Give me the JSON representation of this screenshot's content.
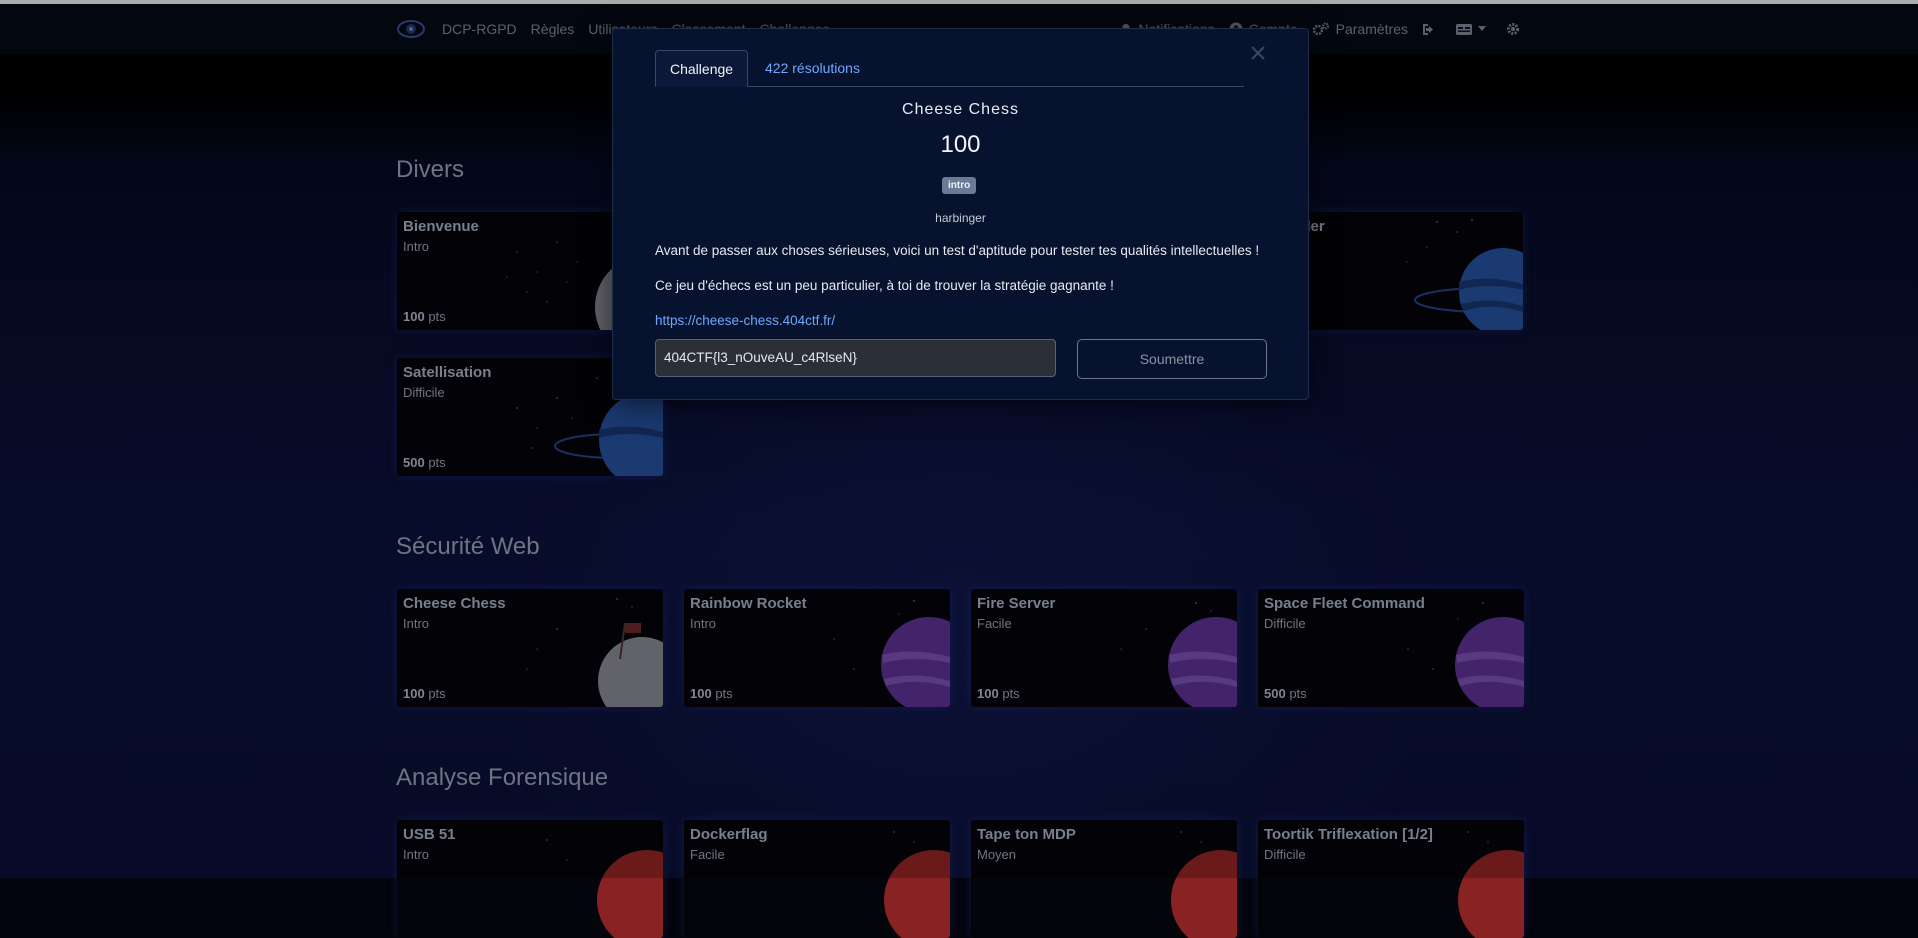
{
  "navbar": {
    "links": [
      "DCP-RGPD",
      "Règles",
      "Utilisateurs",
      "Classement",
      "Challenges"
    ],
    "right": {
      "notifications": "Notifications",
      "account": "Compte",
      "settings": "Paramètres"
    }
  },
  "sections": [
    {
      "title": "Divers",
      "cards": [
        {
          "name": "Bienvenue",
          "difficulty": "Intro",
          "points": "100",
          "unit": "pts"
        },
        {
          "name": "Traveller",
          "difficulty": "",
          "points": "",
          "unit": ""
        },
        {
          "name": "Satellisation",
          "difficulty": "Difficile",
          "points": "500",
          "unit": "pts"
        }
      ]
    },
    {
      "title": "Sécurité Web",
      "cards": [
        {
          "name": "Cheese Chess",
          "difficulty": "Intro",
          "points": "100",
          "unit": "pts"
        },
        {
          "name": "Rainbow Rocket",
          "difficulty": "Intro",
          "points": "100",
          "unit": "pts"
        },
        {
          "name": "Fire Server",
          "difficulty": "Facile",
          "points": "100",
          "unit": "pts"
        },
        {
          "name": "Space Fleet Command",
          "difficulty": "Difficile",
          "points": "500",
          "unit": "pts"
        }
      ]
    },
    {
      "title": "Analyse Forensique",
      "cards": [
        {
          "name": "USB 51",
          "difficulty": "Intro"
        },
        {
          "name": "Dockerflag",
          "difficulty": "Facile"
        },
        {
          "name": "Tape ton MDP",
          "difficulty": "Moyen"
        },
        {
          "name": "Toortik Triflexation [1/2]",
          "difficulty": "Difficile"
        }
      ]
    }
  ],
  "modal": {
    "tabs": [
      "Challenge",
      "422 résolutions"
    ],
    "title": "Cheese Chess",
    "value": "100",
    "tag": "intro",
    "author": "harbinger",
    "description": [
      "Avant de passer aux choses sérieuses, voici un test d'aptitude pour tester tes qualités intellectuelles !",
      "Ce jeu d'échecs est un peu particulier, à toi de trouver la stratégie gagnante !"
    ],
    "link": "https://cheese-chess.404ctf.fr/",
    "input_value": "404CTF{l3_nOuveAU_c4RlseN}",
    "submit_label": "Soumettre"
  },
  "colors": {
    "accent_link": "#6ea8fe",
    "modal_bg": "#07132e",
    "page_bg": "#0a1036"
  }
}
